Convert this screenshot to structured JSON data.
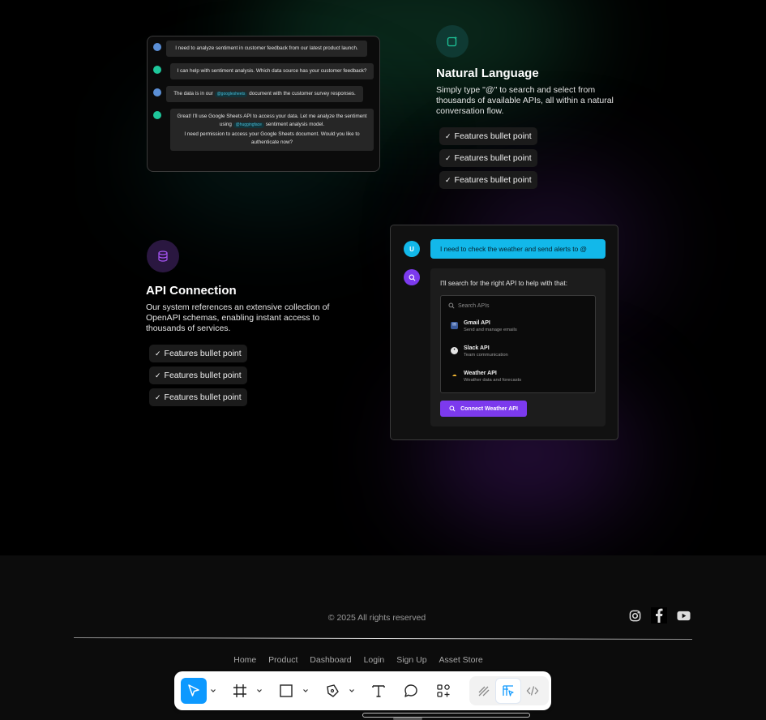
{
  "section1": {
    "chat": [
      {
        "role": "user",
        "text": "I need to analyze sentiment in customer feedback from our latest product launch."
      },
      {
        "role": "ai",
        "text": "I can help with sentiment analysis. Which data source has your customer feedback?"
      },
      {
        "role": "user",
        "text_before": "The data is in our",
        "chip": "@googlesheets",
        "text_after": "document with the customer survey responses."
      },
      {
        "role": "ai",
        "text_before": "Great! I'll use Google Sheets API to access your data. Let me analyze the sentiment using",
        "chip": "@huggingface",
        "text_after": "sentiment analysis model.",
        "text2": "I need permission to access your Google Sheets document. Would you like to authenticate now?"
      }
    ],
    "title": "Natural Language",
    "description": "Simply type \"@\" to search and select from thousands of available APIs, all within a natural conversation flow.",
    "bullets": [
      "Features bullet point",
      "Features bullet point",
      "Features bullet point"
    ],
    "icon": "sparkle-square-icon",
    "icon_color": "#1ec79b"
  },
  "section2": {
    "title": "API Connection",
    "description": "Our system references an extensive collection of OpenAPI schemas, enabling instant access to thousands of services.",
    "bullets": [
      "Features bullet point",
      "Features bullet point",
      "Features bullet point"
    ],
    "icon": "database-icon",
    "icon_color": "#a855f7",
    "card": {
      "user_avatar": "U",
      "user_message": "I need to check the weather and send alerts to @",
      "ai_message": "I'll search for the right API to help with that:",
      "search_placeholder": "Search APIs",
      "apis": [
        {
          "name": "Gmail API",
          "sub": "Send and manage emails",
          "icon": "mail-icon"
        },
        {
          "name": "Slack API",
          "sub": "Team communication",
          "icon": "chat-icon"
        },
        {
          "name": "Weather API",
          "sub": "Weather data and forecasts",
          "icon": "weather-icon"
        }
      ],
      "connect_label": "Connect Weather API",
      "accent": "#12b8ea",
      "button_color": "#7c3aed"
    }
  },
  "footer": {
    "copyright": "© 2025 All rights  reserved",
    "nav": [
      "Home",
      "Product",
      "Dashboard",
      "Login",
      "Sign Up",
      "Asset Store"
    ],
    "socials": [
      "instagram-icon",
      "facebook-icon",
      "youtube-icon"
    ]
  },
  "toolbar": {
    "tools": [
      "move-tool",
      "frame-tool",
      "shape-tool",
      "pen-tool",
      "text-tool",
      "comment-tool",
      "actions-tool",
      "draw-mode",
      "design-mode",
      "dev-mode"
    ],
    "active": "move-tool"
  }
}
